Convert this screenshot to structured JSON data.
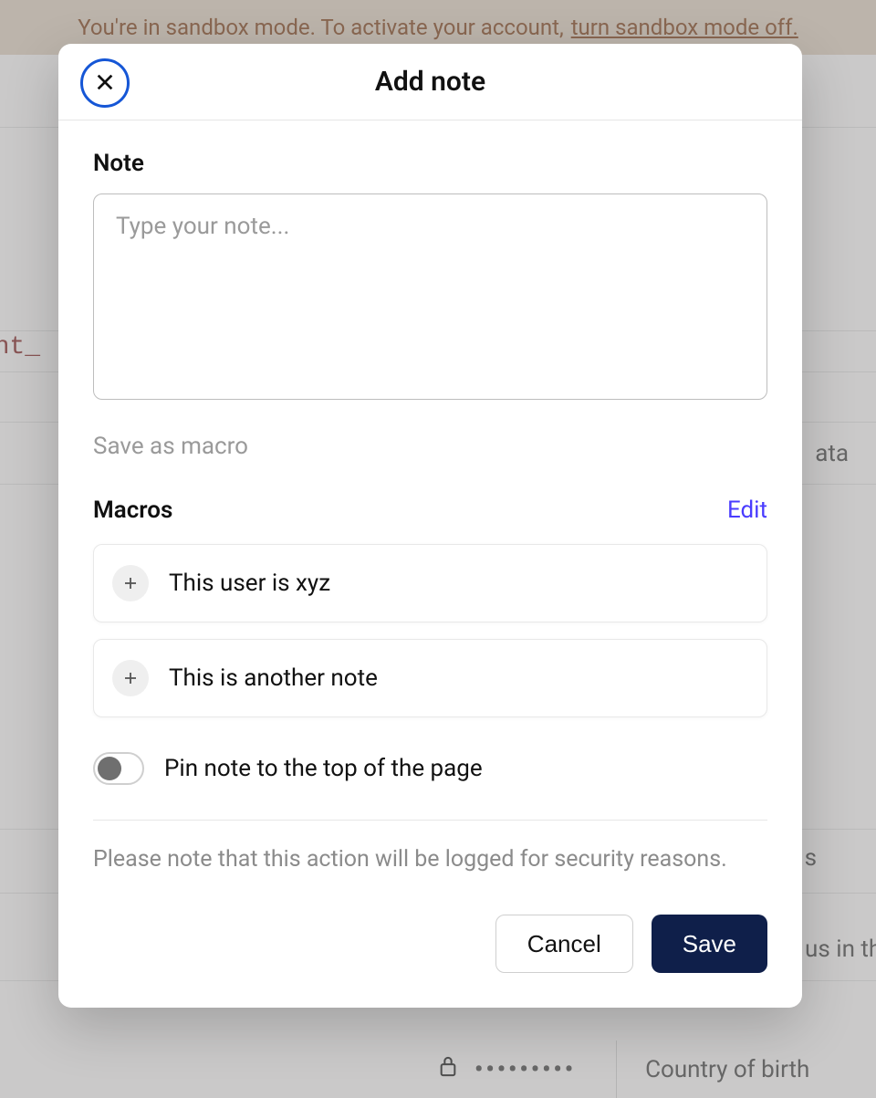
{
  "sandbox": {
    "message": "You're in sandbox mode. To activate your account,",
    "link": "turn sandbox mode off."
  },
  "bg": {
    "rint": "rint_",
    "ata": "ata",
    "s": "s",
    "usin": "us in the",
    "cob": "Country of birth",
    "dots": "•••••••••"
  },
  "modal": {
    "title": "Add note",
    "note_label": "Note",
    "note_placeholder": "Type your note...",
    "note_value": "",
    "save_as_macro": "Save as macro",
    "macros_label": "Macros",
    "edit": "Edit",
    "macros": [
      {
        "text": "This user is xyz"
      },
      {
        "text": "This is another note"
      }
    ],
    "pin_label": "Pin note to the top of the page",
    "pin_on": false,
    "disclaimer": "Please note that this action will be logged for security reasons.",
    "cancel": "Cancel",
    "save": "Save"
  }
}
